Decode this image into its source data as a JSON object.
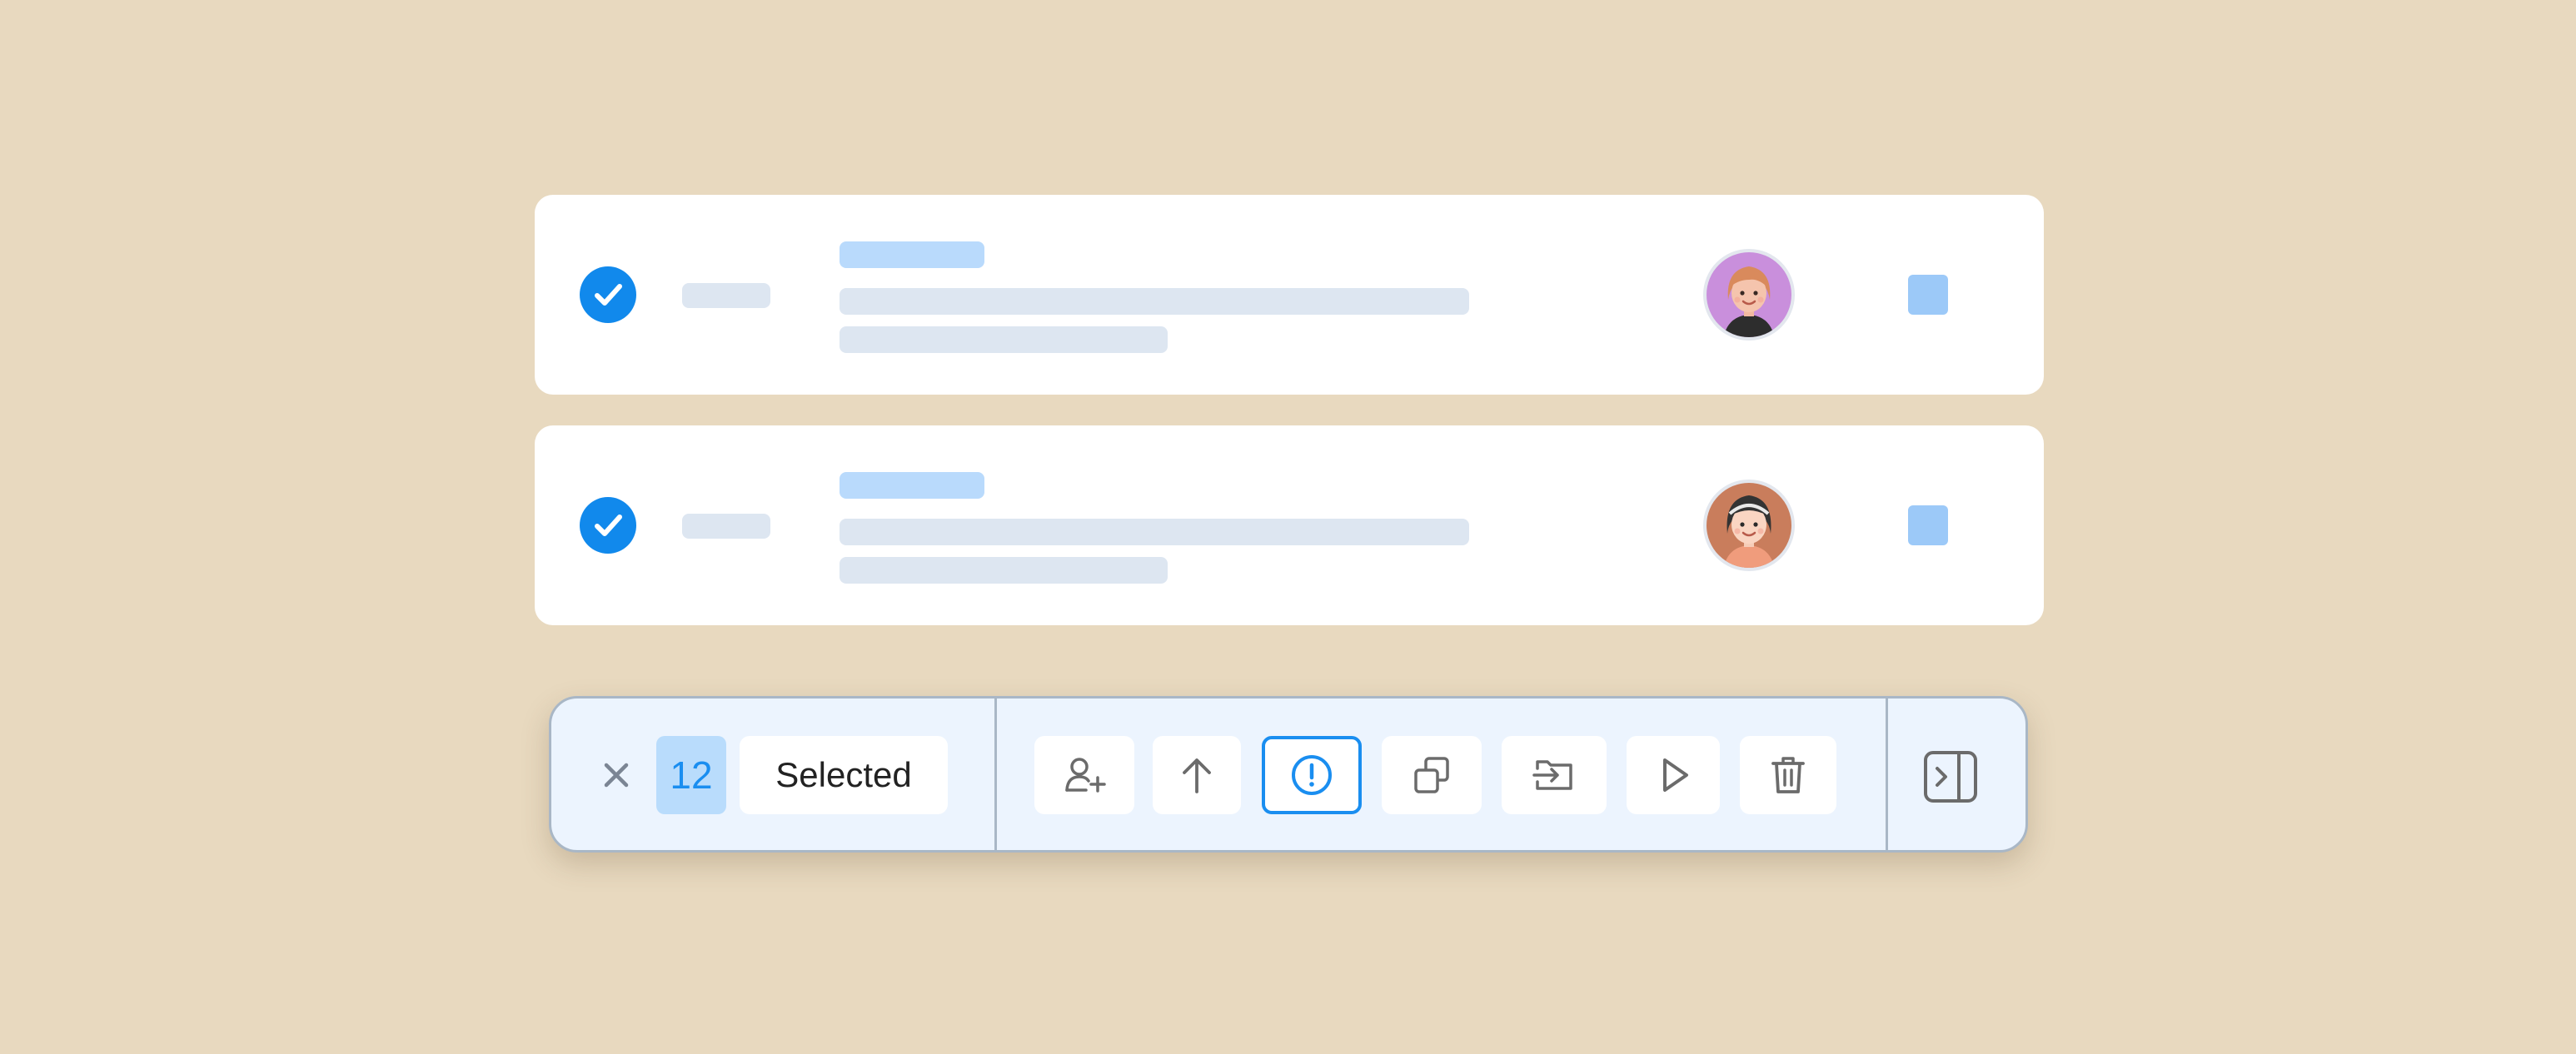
{
  "rows": [
    {
      "checked": true,
      "avatar": "avatar-woman-purple"
    },
    {
      "checked": true,
      "avatar": "avatar-woman-headband"
    }
  ],
  "bulk_toolbar": {
    "close_icon": "close-icon",
    "selected_count": "12",
    "selected_label": "Selected",
    "actions": [
      {
        "icon": "add-user-icon"
      },
      {
        "icon": "arrow-up-icon"
      },
      {
        "icon": "alert-circle-icon",
        "active": true
      },
      {
        "icon": "duplicate-icon"
      },
      {
        "icon": "move-to-folder-icon"
      },
      {
        "icon": "play-icon"
      },
      {
        "icon": "trash-icon"
      }
    ],
    "panel_icon": "expand-panel-icon"
  },
  "colors": {
    "background": "#e8d9bf",
    "accent": "#1189ec",
    "toolbar_background": "#ecf4fe",
    "toolbar_border": "#a9b7c6",
    "placeholder_light": "#dde6f1",
    "placeholder_blue": "#b9dafc",
    "status_square": "#9cc9f8"
  }
}
